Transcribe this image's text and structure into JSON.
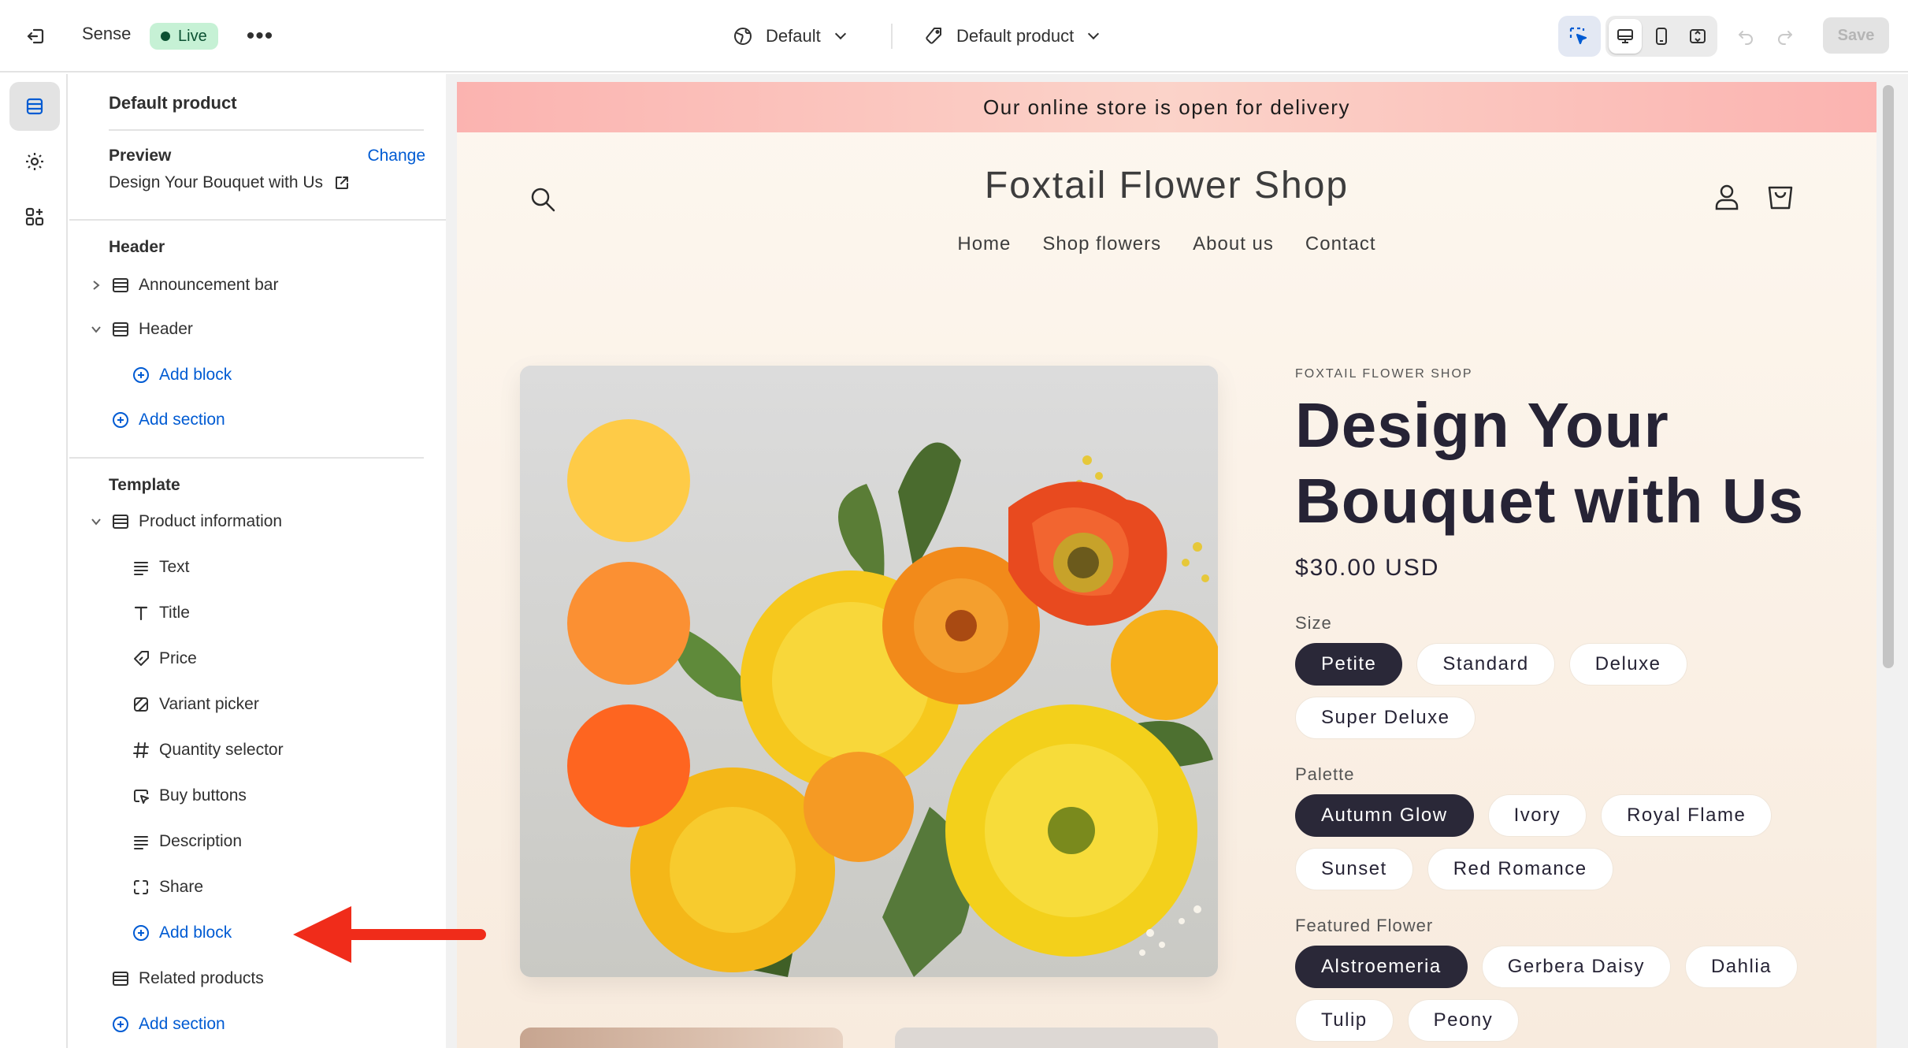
{
  "topbar": {
    "app_name": "Sense",
    "status_badge": "Live",
    "more_label": "•••",
    "theme_select": "Default",
    "template_select": "Default product",
    "save_label": "Save"
  },
  "sidebar": {
    "title": "Default product",
    "preview": {
      "label": "Preview",
      "change_label": "Change",
      "value": "Design Your Bouquet with Us"
    },
    "header_group": {
      "label": "Header",
      "items": [
        {
          "label": "Announcement bar",
          "icon": "section-icon",
          "expanded": false
        },
        {
          "label": "Header",
          "icon": "section-icon",
          "expanded": true
        }
      ],
      "add_block": "Add block",
      "add_section": "Add section"
    },
    "template_group": {
      "label": "Template",
      "section": {
        "label": "Product information",
        "icon": "section-icon",
        "expanded": true
      },
      "blocks": [
        {
          "label": "Text",
          "icon": "text-lines-icon"
        },
        {
          "label": "Title",
          "icon": "title-t-icon"
        },
        {
          "label": "Price",
          "icon": "price-tag-icon"
        },
        {
          "label": "Variant picker",
          "icon": "variant-picker-icon"
        },
        {
          "label": "Quantity selector",
          "icon": "hash-icon"
        },
        {
          "label": "Buy buttons",
          "icon": "cursor-click-icon"
        },
        {
          "label": "Description",
          "icon": "text-lines-icon"
        },
        {
          "label": "Share",
          "icon": "share-frame-icon"
        }
      ],
      "add_block": "Add block",
      "related": {
        "label": "Related products",
        "icon": "section-icon"
      },
      "add_section": "Add section"
    }
  },
  "storefront": {
    "announcement": "Our online store is open for delivery",
    "store_name": "Foxtail Flower Shop",
    "nav": [
      "Home",
      "Shop flowers",
      "About us",
      "Contact"
    ],
    "product": {
      "vendor": "FOXTAIL FLOWER SHOP",
      "title": "Design Your Bouquet with Us",
      "price": "$30.00 USD",
      "options": [
        {
          "label": "Size",
          "values": [
            "Petite",
            "Standard",
            "Deluxe",
            "Super Deluxe"
          ],
          "selected": "Petite"
        },
        {
          "label": "Palette",
          "values": [
            "Autumn Glow",
            "Ivory",
            "Royal Flame",
            "Sunset",
            "Red Romance"
          ],
          "selected": "Autumn Glow"
        },
        {
          "label": "Featured Flower",
          "values": [
            "Alstroemeria",
            "Gerbera Daisy",
            "Dahlia",
            "Tulip",
            "Peony"
          ],
          "selected": "Alstroemeria"
        }
      ]
    }
  },
  "colors": {
    "accent_link": "#005bd3",
    "live_badge_bg": "#c6f1d5",
    "selected_pill": "#2a2838",
    "announcement_bg": "#fbb3b0",
    "swatch_yellow": "#fecb47",
    "swatch_orange": "#fb9033",
    "swatch_red_orange": "#fe6520",
    "annotation_arrow": "#f02c1a"
  }
}
